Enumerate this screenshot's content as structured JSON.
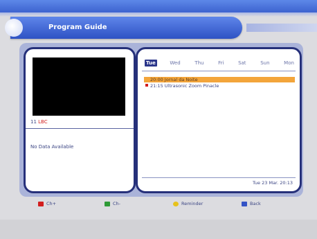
{
  "header": {
    "title": "Program Guide"
  },
  "channel": {
    "number": "11",
    "name": "LBC"
  },
  "info": {
    "no_data": "No Data Available"
  },
  "days": [
    "Tue",
    "Wed",
    "Thu",
    "Fri",
    "Sat",
    "Sun",
    "Mon"
  ],
  "events": [
    {
      "time_title": "20:00 Jornal da Noite",
      "selected": true
    },
    {
      "time_title": "21:15 Ultrasonic Zoom Pinacle",
      "selected": false
    }
  ],
  "status": {
    "date_time": "Tue 23 Mar.   20:13"
  },
  "footer": {
    "red": "Ch+",
    "green": "Ch-",
    "yellow": "Reminder",
    "blue": "Back"
  },
  "colors": {
    "header_blue": "#3d63cf",
    "panel_border": "#26307a",
    "highlight": "#f3a53b",
    "text": "#3c4684",
    "red": "#d21e1e"
  }
}
